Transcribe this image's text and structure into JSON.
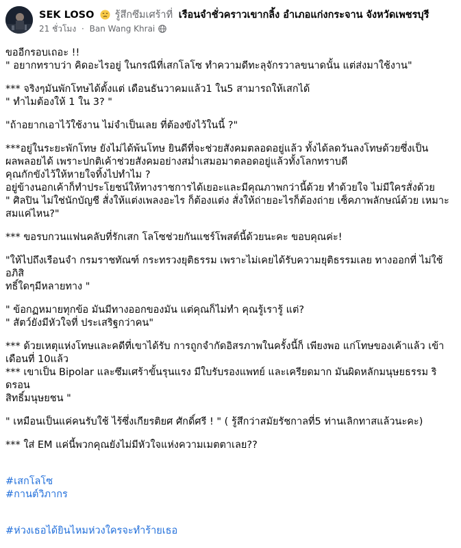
{
  "post": {
    "author": "SEK LOSO",
    "feeling_emoji": "sad-face-emoji",
    "feeling": "รู้สึกซึมเศร้าที่",
    "location": "เรือนจำชั่วคราวเขากลิ้ง อำเภอแก่งกระจาน จังหวัดเพชรบุรี",
    "time": "21 ชั่วโมง",
    "place": "Ban Wang Khrai",
    "audience_icon": "globe-icon"
  },
  "body": {
    "p1": "ขออีกรอบเถอะ !!\n\" อยากทราบว่า คิดอะไรอยู่ ในกรณีที่เสกโลโซ ทำความดีทะลุจักรวาลขนาดนั้น แต่ส่งมาใช้งาน\"",
    "p2": "*** จริงๆมันพักโทษได้ตั้งแต่ เดือนธันวาคมแล้ว1 ใน5 สามารถให้เสกได้\n\" ทำไมต้องให้ 1 ใน 3? \"",
    "p3": "\"ถ้าอยากเอาไว้ใช้งาน ไม่จำเป็นเลย ที่ต้องขังไว้ในนี้ ?\"",
    "p4": "***อยู่ในระยะพักโทษ ยังไม่ได้พ้นโทษ ยินดีที่จะช่วยสังคมตลอดอยู่แล้ว ทั้งได้ลดวันลงโทษด้วยซึ่งเป็น\nผลพลอยได้ เพราะปกติเค้าช่วยสังคมอย่างสม่ำเสมอมาตลอดอยู่แล้วทั้งโลกทราบดี\nคุณกักขังไว้ให้หายใจทิ้งไปทำไม ?\nอยู่ข้างนอกเค้าก็ทำประโยชน์ให้ทางราชการได้เยอะและมีคุณภาพกว่านี้ด้วย ทำด้วยใจ ไม่มีใครสั่งด้วย\n\" ศิลปิน ไม่ใช่นักบัญชี สั่งให้แต่งเพลงอะไร ก็ต้องแต่ง สั่งให้ถ่ายอะไรก็ต้องถ่าย  เซ็คภาพลักษณ์ด้วย เหมาะ\nสมแค่ไหน?\"",
    "p5": "  *** ขอรบกวนแฟนคลับที่รักเสก โลโซช่วยกันแชร์โพสต์นี้ด้วยนะคะ ขอบคุณค่ะ!",
    "p6": "\"ให้ไปถึงเรือนจำ กรมราชทัณฑ์ กระทรวงยุติธรรม เพราะไม่เคยได้รับความยุติธรรมเลย ทางออกที่ ไม่ใช้อภิสิ\nทธิ์ใดๆมีหลายทาง \"",
    "p7": "\" ข้อกฏหมายทุกข้อ มันมีทางออกของมัน แต่คุณก็ไม่ทำ คุณรู้เรารู้ แต่?\n\" สัตว์ยังมีหัวใจที่ ประเสริฐกว่าคน\"",
    "p8": "*** ด้วยเหตุแห่งโทษและคดีที่เขาได้รับ การถูกจำกัดอิสรภาพในครั้งนี้ก็ เพียงพอ แก่โทษของเค้าแล้ว เข้า\nเดือนที่ 10แล้ว\n*** เขาเป็น Bipolar และซึมเศร้าขั้นรุนแรง มีใบรับรองแพทย์ และเครียดมาก มันผิดหลักมนุษยธรรม ริดรอน\nสิทธิ์มนุษยชน \"",
    "p9": "\" เหมือนเป็นแค่คนรับใช้ ไร้ซึ่งเกียรติยศ ศักดิ์ศรี   ! \" ( รู้สึกว่าสมัยรัชกาลที่5 ท่านเลิกทาสแล้วนะคะ)",
    "p10": "*** ใส่ EM แค่นี้พวกคุณยังไม่มีหัวใจแห่งความเมตตาเลย??",
    "hashtags1": [
      "#เสกโลโซ",
      "#กานต์วิภากร"
    ],
    "hashtags2": "#ห่วงเธอได้ยินไหมห่วงใครจะทำร้ายเธอ"
  }
}
